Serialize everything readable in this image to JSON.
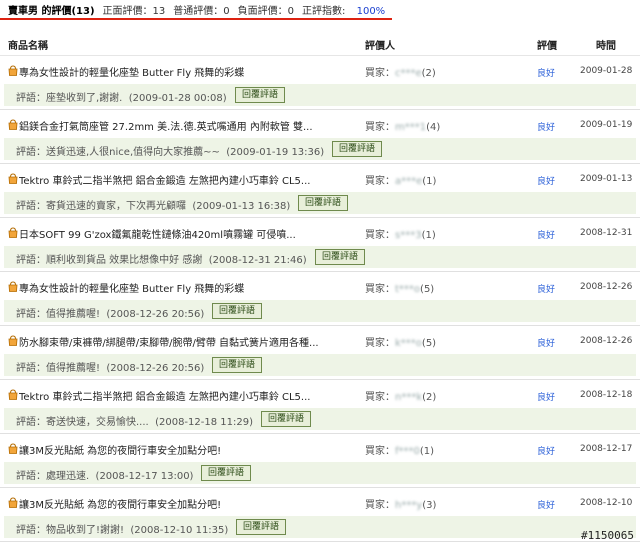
{
  "summary": {
    "seller": "賣車男 的評價(13)",
    "positive": "正面評價：13",
    "neutral": "普通評價：0",
    "negative": "負面評價：0",
    "index_label": "正評指數:",
    "index_value": "100%"
  },
  "columns": {
    "item": "商品名稱",
    "rater": "評價人",
    "rating": "評價",
    "time": "時間"
  },
  "entries": [
    {
      "item": "專為女性設計的輕量化座墊 Butter Fly 飛舞的彩蝶",
      "rater_prefix": "買家：",
      "rater_id": "c***e",
      "rater_count": "(2)",
      "rating": "良好",
      "date": "2009-01-28",
      "comment_label": "評語：",
      "comment": "座墊收到了,謝謝.",
      "comment_time": "(2009-01-28 00:08)",
      "reply": "回覆評語"
    },
    {
      "item": "鋁鎂合金打氣筒座管 27.2mm 美.法.德.英式嘴通用 內附軟管 雙...",
      "rater_prefix": "買家：",
      "rater_id": "m***1",
      "rater_count": "(4)",
      "rating": "良好",
      "date": "2009-01-19",
      "comment_label": "評語：",
      "comment": "送貨迅速,人很nice,值得向大家推薦~~",
      "comment_time": "(2009-01-19 13:36)",
      "reply": "回覆評語"
    },
    {
      "item": "Tektro 車鈴式二指半煞把 鋁合金鍛造 左煞把內建小巧車鈴 CL5...",
      "rater_prefix": "買家：",
      "rater_id": "a***e",
      "rater_count": "(1)",
      "rating": "良好",
      "date": "2009-01-13",
      "comment_label": "評語：",
      "comment": "寄貨迅速的賣家，下次再光顧囉",
      "comment_time": "(2009-01-13 16:38)",
      "reply": "回覆評語"
    },
    {
      "item": "日本SOFT 99 G'zox鐵氟龍乾性鏈條油420ml噴霧罐 可侵噴...",
      "rater_prefix": "買家：",
      "rater_id": "s***3",
      "rater_count": "(1)",
      "rating": "良好",
      "date": "2008-12-31",
      "comment_label": "評語：",
      "comment": "順利收到貨品 效果比想像中好 感謝",
      "comment_time": "(2008-12-31 21:46)",
      "reply": "回覆評語"
    },
    {
      "item": "專為女性設計的輕量化座墊 Butter Fly 飛舞的彩蝶",
      "rater_prefix": "買家：",
      "rater_id": "t***o",
      "rater_count": "(5)",
      "rating": "良好",
      "date": "2008-12-26",
      "comment_label": "評語：",
      "comment": "值得推薦喔!",
      "comment_time": "(2008-12-26 20:56)",
      "reply": "回覆評語"
    },
    {
      "item": "防水腳束帶/束褲帶/綁腿帶/束腳帶/腕帶/臂帶 自黏式簧片適用各種...",
      "rater_prefix": "買家：",
      "rater_id": "k***o",
      "rater_count": "(5)",
      "rating": "良好",
      "date": "2008-12-26",
      "comment_label": "評語：",
      "comment": "值得推薦喔!",
      "comment_time": "(2008-12-26 20:56)",
      "reply": "回覆評語"
    },
    {
      "item": "Tektro 車鈴式二指半煞把 鋁合金鍛造 左煞把內建小巧車鈴 CL5...",
      "rater_prefix": "買家：",
      "rater_id": "n***k",
      "rater_count": "(2)",
      "rating": "良好",
      "date": "2008-12-18",
      "comment_label": "評語：",
      "comment": "寄送快速，交易愉快....",
      "comment_time": "(2008-12-18 11:29)",
      "reply": "回覆評語"
    },
    {
      "item": "讓3M反光貼紙 為您的夜間行車安全加點分吧!",
      "rater_prefix": "買家：",
      "rater_id": "f***0",
      "rater_count": "(1)",
      "rating": "良好",
      "date": "2008-12-17",
      "comment_label": "評語：",
      "comment": "處理迅速.",
      "comment_time": "(2008-12-17 13:00)",
      "reply": "回覆評語"
    },
    {
      "item": "讓3M反光貼紙 為您的夜間行車安全加點分吧!",
      "rater_prefix": "買家：",
      "rater_id": "h***y",
      "rater_count": "(3)",
      "rating": "良好",
      "date": "2008-12-10",
      "comment_label": "評語：",
      "comment": "物品收到了!謝謝!",
      "comment_time": "(2008-12-10 11:35)",
      "reply": "回覆評語"
    }
  ],
  "watermark": "#1150065",
  "colors": {
    "accent_red": "#dd2211",
    "link_blue": "#2a5fd8",
    "comment_bg": "#eef4e6",
    "button_border": "#6f8a4d"
  },
  "icons": {
    "item": "shopping-bag-icon"
  }
}
